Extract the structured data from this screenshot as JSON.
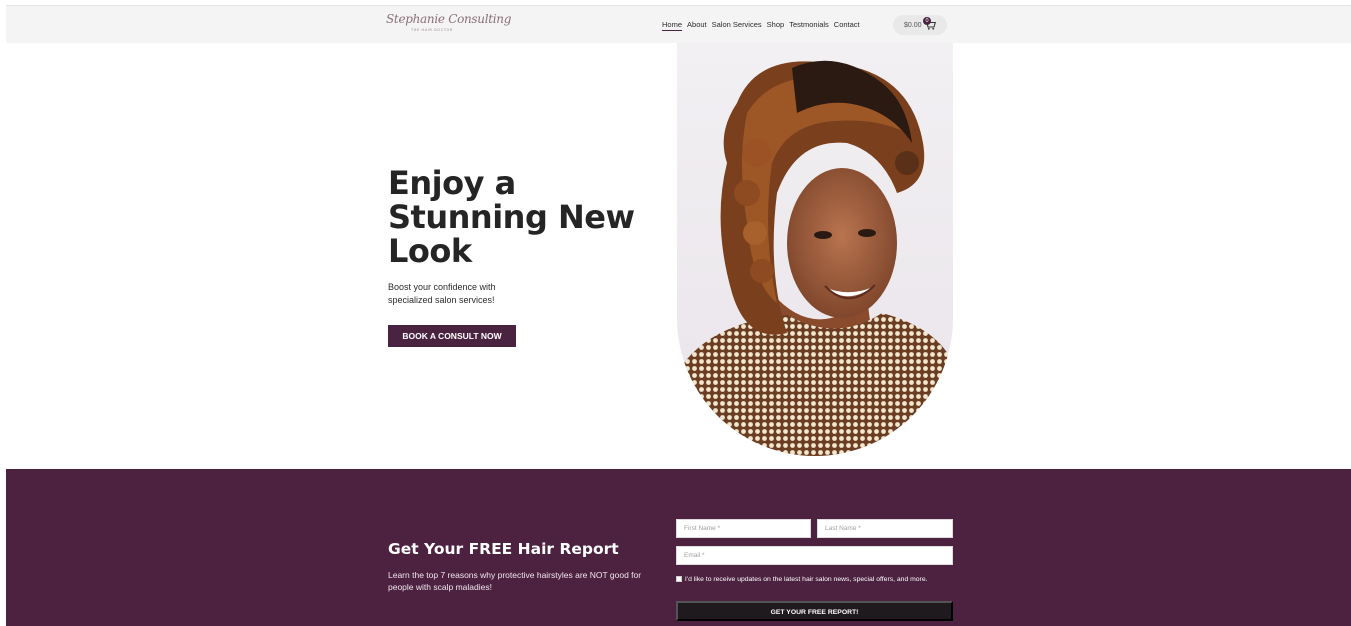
{
  "header": {
    "logo_script": "Stephanie Consulting",
    "logo_tagline": "THE HAIR DOCTOR",
    "nav": [
      {
        "label": "Home"
      },
      {
        "label": "About"
      },
      {
        "label": "Salon Services"
      },
      {
        "label": "Shop"
      },
      {
        "label": "Testmonials"
      },
      {
        "label": "Contact"
      }
    ],
    "cart_amount": "$0.00",
    "cart_count": "0",
    "cart_icon": "cart-icon"
  },
  "hero": {
    "title": "Enjoy a Stunning New Look",
    "subtitle": "Boost your confidence with specialized salon services!",
    "cta_label": "BOOK A CONSULT NOW",
    "image": "portrait-woman-curly-hair"
  },
  "report": {
    "title": "Get Your FREE Hair Report",
    "description": "Learn the top 7 reasons why protective hairstyles are NOT good for people with scalp maladies!",
    "first_name_placeholder": "First Name *",
    "last_name_placeholder": "Last Name *",
    "email_placeholder": "Email *",
    "consent_text": "I'd like to receive updates on the latest hair salon news, special offers, and more.",
    "submit_label": "GET YOUR FREE REPORT!"
  },
  "colors": {
    "brand": "#4a2340",
    "band": "#4c2240",
    "header_bg": "#f4f4f4",
    "submit_bg": "#1f1a1d"
  }
}
